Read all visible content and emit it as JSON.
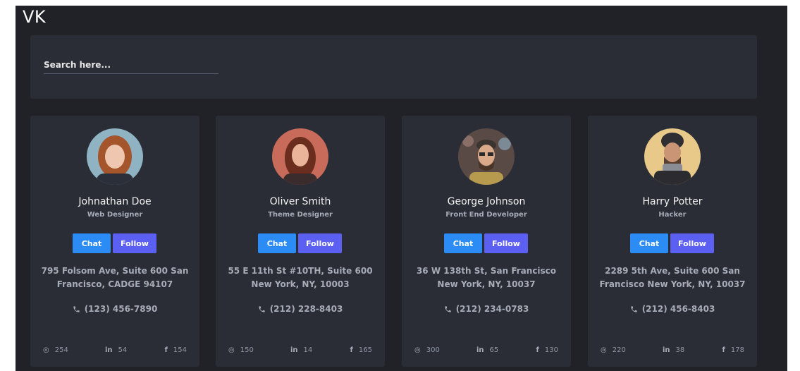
{
  "brand": "VK",
  "search": {
    "placeholder": "Search here..."
  },
  "buttons": {
    "chat": "Chat",
    "follow": "Follow"
  },
  "profiles": [
    {
      "name": "Johnathan Doe",
      "role": "Web Designer",
      "address": "795 Folsom Ave, Suite 600 San Francisco, CADGE 94107",
      "phone": "(123) 456-7890",
      "instagram": "254",
      "linkedin": "54",
      "facebook": "154"
    },
    {
      "name": "Oliver Smith",
      "role": "Theme Designer",
      "address": "55 E 11th St #10TH, Suite 600 New York, NY, 10003",
      "phone": "(212) 228-8403",
      "instagram": "150",
      "linkedin": "14",
      "facebook": "165"
    },
    {
      "name": "George Johnson",
      "role": "Front End Developer",
      "address": "36 W 138th St, San Francisco New York, NY, 10037",
      "phone": "(212) 234-0783",
      "instagram": "300",
      "linkedin": "65",
      "facebook": "130"
    },
    {
      "name": "Harry Potter",
      "role": "Hacker",
      "address": "2289 5th Ave, Suite 600 San Francisco New York, NY, 10037",
      "phone": "(212) 456-8403",
      "instagram": "220",
      "linkedin": "38",
      "facebook": "178"
    }
  ],
  "colors": {
    "background": "#202228",
    "panel": "#2a2d35",
    "chat_button": "#2b8cf5",
    "follow_button": "#5b5ff2"
  },
  "icons": [
    "phone-icon",
    "instagram-icon",
    "linkedin-icon",
    "facebook-icon"
  ]
}
